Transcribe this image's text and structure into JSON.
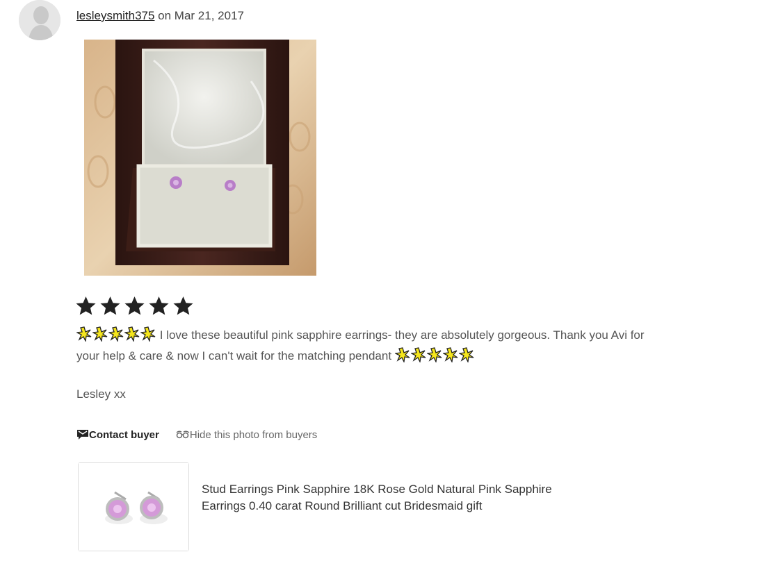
{
  "review": {
    "username": "lesleysmith375",
    "date_text": " on Mar 21, 2017",
    "rating": 5,
    "text_line1": "I love these beautiful pink sapphire earrings- they are absolutely gorgeous. Thank you Avi for your help & care & now I can't wait for the matching pendant",
    "sign_off": "Lesley xx"
  },
  "actions": {
    "contact_label": "Contact buyer",
    "hide_label": "Hide this photo from buyers"
  },
  "listing": {
    "title": "Stud Earrings Pink Sapphire 18K Rose Gold Natural Pink Sapphire Earrings 0.40 carat Round Brilliant cut Bridesmaid gift"
  },
  "colors": {
    "star": "#222222",
    "sparkle_fill": "#f5e61c",
    "stone_pink": "#c88fd0"
  }
}
